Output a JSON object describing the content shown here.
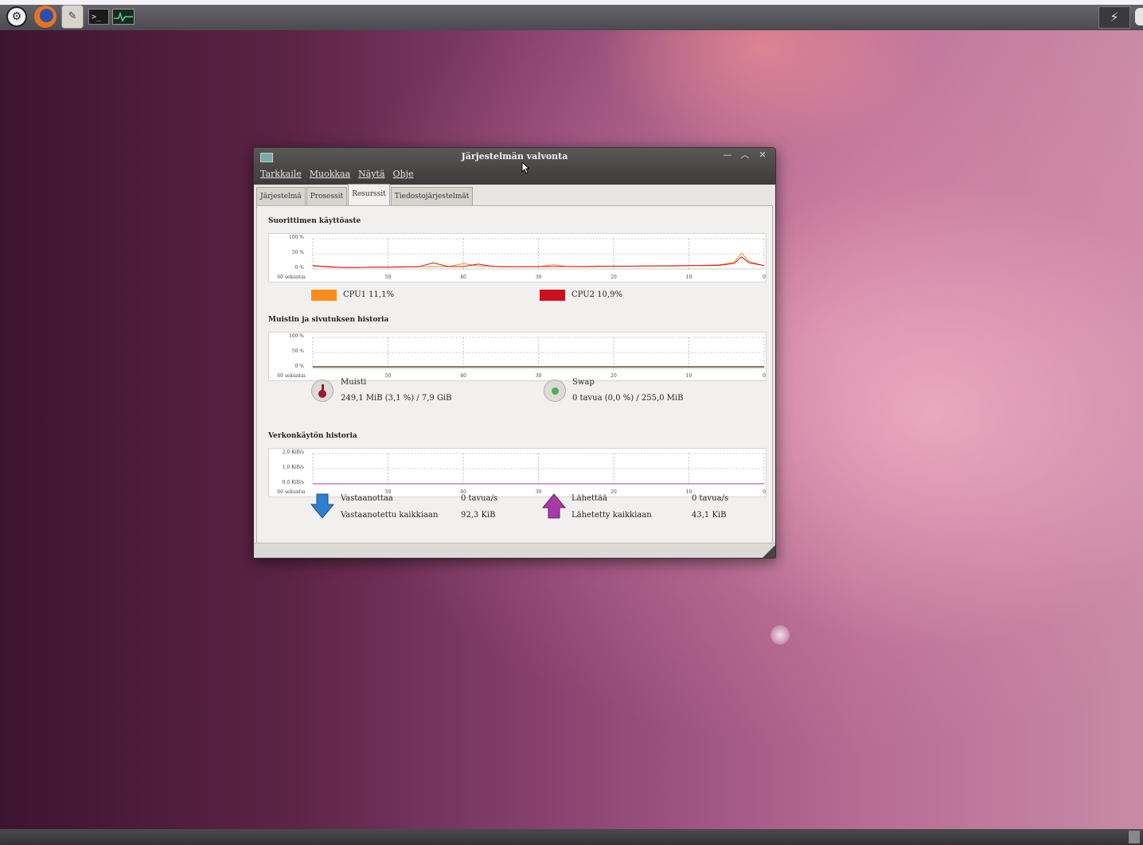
{
  "colors": {
    "cpu1": "#ff8c1a",
    "cpu2": "#cc1020",
    "memory": "#9b1b30",
    "swap": "#4caf50",
    "download": "#2f7fd0",
    "upload": "#a83aa8"
  },
  "launchers": [
    {
      "icon": "ubuntu-logo-icon"
    },
    {
      "icon": "firefox-icon"
    },
    {
      "icon": "gimp-icon"
    },
    {
      "icon": "terminal-icon"
    },
    {
      "icon": "system-monitor-icon"
    }
  ],
  "window": {
    "title": "Järjestelmän valvonta",
    "menu": [
      "Tarkkaile",
      "Muokkaa",
      "Näytä",
      "Ohje"
    ],
    "tabs": [
      "Järjestelmä",
      "Prosessit",
      "Resurssit",
      "Tiedostojärjestelmät"
    ],
    "active_tab": "Resurssit"
  },
  "cpu": {
    "title": "Suorittimen käyttöaste",
    "y_ticks": [
      "100 %",
      "50 %",
      "0 %"
    ],
    "x_ticks": [
      "60 sekuntia",
      "50",
      "40",
      "30",
      "20",
      "10",
      "0"
    ],
    "cpu1_label": "CPU1  11,1%",
    "cpu2_label": "CPU2  10,9%"
  },
  "memory": {
    "title": "Muistin ja sivutuksen historia",
    "y_ticks": [
      "100 %",
      "50 %",
      "0 %"
    ],
    "x_ticks": [
      "60 sekuntia",
      "50",
      "40",
      "30",
      "20",
      "10",
      "0"
    ],
    "mem_label": "Muisti",
    "mem_value": "249,1 MiB (3,1 %) / 7,9 GiB",
    "swap_label": "Swap",
    "swap_value": "0 tavua (0,0 %) / 255,0 MiB"
  },
  "network": {
    "title": "Verkonkäytön historia",
    "y_ticks": [
      "2,0 KiB/s",
      "1,0 KiB/s",
      "0,0 KiB/s"
    ],
    "x_ticks": [
      "60 sekuntia",
      "50",
      "40",
      "30",
      "20",
      "10",
      "0"
    ],
    "recv_label": "Vastaanottaa",
    "recv_rate": "0 tavua/s",
    "recv_total_label": "Vastaanotettu kaikkiaan",
    "recv_total": "92,3 KiB",
    "send_label": "Lähettää",
    "send_rate": "0 tavua/s",
    "send_total_label": "Lähetetty kaikkiaan",
    "send_total": "43,1 KiB"
  },
  "chart_data": [
    {
      "type": "line",
      "title": "Suorittimen käyttöaste",
      "x": [
        60,
        58,
        56,
        54,
        52,
        50,
        48,
        46,
        44,
        42,
        40,
        38,
        36,
        34,
        32,
        30,
        28,
        26,
        24,
        22,
        20,
        18,
        16,
        14,
        12,
        10,
        8,
        6,
        4,
        3,
        2,
        0
      ],
      "ylim": [
        0,
        100
      ],
      "series": [
        {
          "name": "CPU1",
          "values": [
            12,
            6,
            5,
            5,
            6,
            6,
            6,
            7,
            8,
            7,
            18,
            10,
            9,
            8,
            8,
            7,
            14,
            7,
            7,
            8,
            9,
            9,
            10,
            10,
            11,
            11,
            12,
            14,
            22,
            52,
            25,
            11
          ]
        },
        {
          "name": "CPU2",
          "values": [
            10,
            8,
            5,
            5,
            6,
            6,
            7,
            7,
            20,
            8,
            8,
            16,
            8,
            7,
            7,
            8,
            8,
            8,
            8,
            9,
            9,
            9,
            10,
            10,
            10,
            11,
            11,
            12,
            18,
            40,
            20,
            11
          ]
        }
      ]
    },
    {
      "type": "line",
      "title": "Muistin ja sivutuksen historia",
      "x": [
        60,
        0
      ],
      "ylim": [
        0,
        100
      ],
      "series": [
        {
          "name": "Muisti",
          "values": [
            3.1,
            3.1
          ]
        },
        {
          "name": "Swap",
          "values": [
            0,
            0
          ]
        }
      ]
    },
    {
      "type": "line",
      "title": "Verkonkäytön historia",
      "x": [
        60,
        0
      ],
      "ylim": [
        0,
        2
      ],
      "series": [
        {
          "name": "Vastaanottaa",
          "values": [
            0,
            0
          ]
        },
        {
          "name": "Lähettää",
          "values": [
            0,
            0
          ]
        }
      ]
    }
  ]
}
